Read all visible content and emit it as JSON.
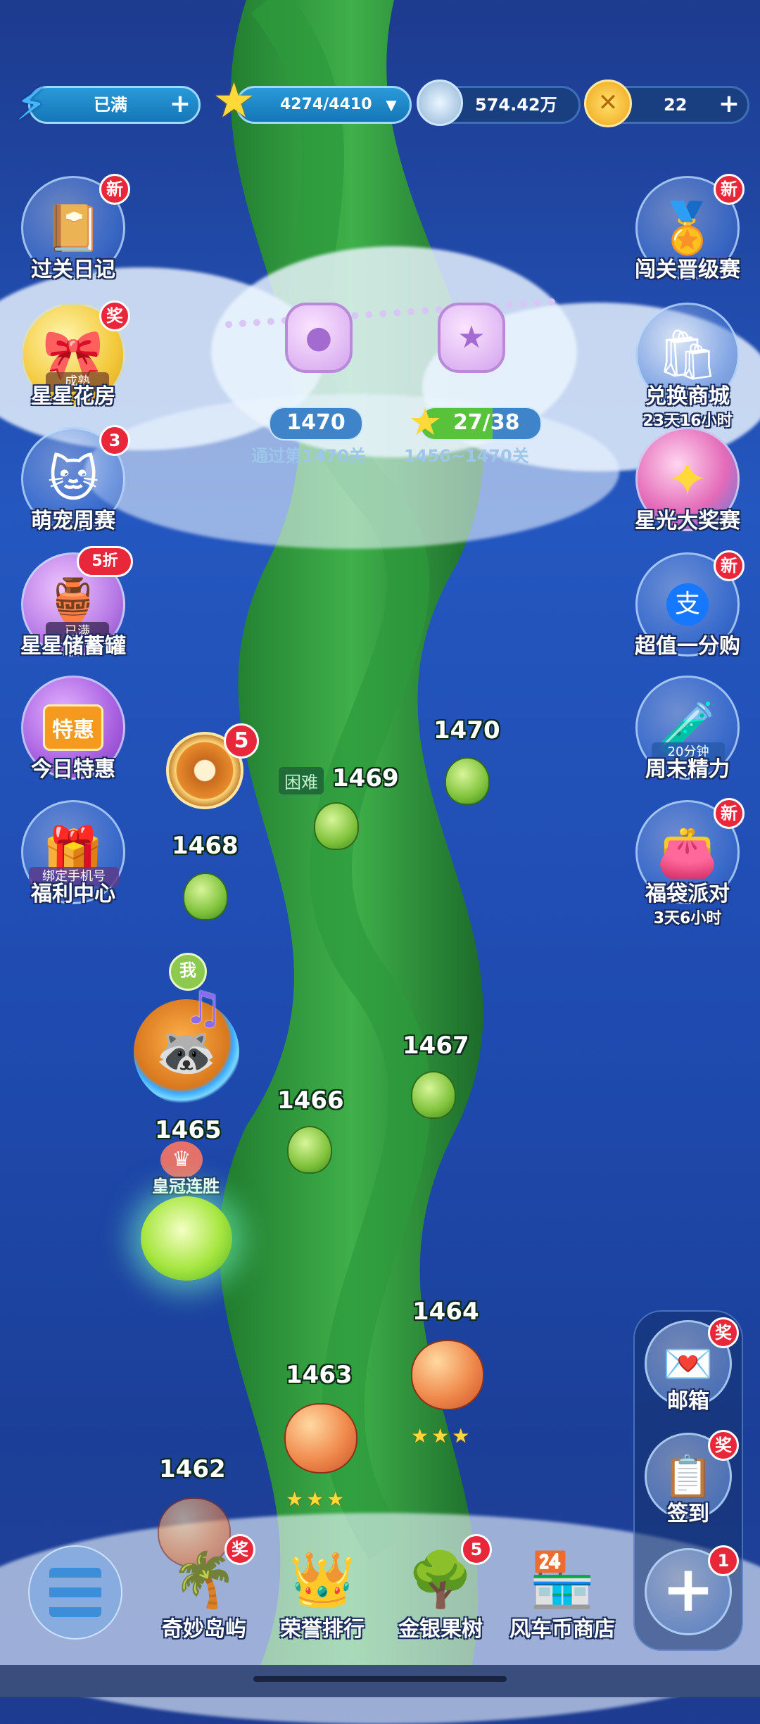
{
  "topbar": {
    "energy_label": "已满",
    "stars_value": "4274/4410",
    "coins_value": "574.42万",
    "gold_value": "22"
  },
  "left_menu": [
    {
      "label": "过关日记",
      "badge": "新",
      "icon": "diary-icon",
      "chip": ""
    },
    {
      "label": "星星花房",
      "badge": "奖",
      "icon": "flower-house-icon",
      "chip": "成熟"
    },
    {
      "label": "萌宠周赛",
      "badge": "3",
      "icon": "cat-icon",
      "chip": ""
    },
    {
      "label": "星星储蓄罐",
      "badge": "5折",
      "icon": "piggy-bank-icon",
      "chip": "已满"
    },
    {
      "label": "今日特惠",
      "badge": "",
      "icon": "shop-stall-icon",
      "chip": "特惠"
    },
    {
      "label": "福利中心",
      "badge": "",
      "icon": "gift-icon",
      "chip": "绑定手机号"
    }
  ],
  "right_menu": [
    {
      "label": "闯关晋级赛",
      "sub": "",
      "badge": "新",
      "icon": "trophy-badge-icon",
      "chip": ""
    },
    {
      "label": "兑换商城",
      "sub": "23天16小时",
      "badge": "",
      "icon": "exchange-shop-icon",
      "chip": ""
    },
    {
      "label": "星光大奖赛",
      "sub": "",
      "badge": "",
      "icon": "star-podium-icon",
      "chip": ""
    },
    {
      "label": "超值一分购",
      "sub": "",
      "badge": "新",
      "icon": "alipay-gift-icon",
      "chip": "支"
    },
    {
      "label": "周末精力",
      "sub": "",
      "badge": "",
      "icon": "potion-icon",
      "chip": "20分钟"
    },
    {
      "label": "福袋派对",
      "sub": "3天6小时",
      "badge": "新",
      "icon": "lucky-bag-icon",
      "chip": ""
    }
  ],
  "gate": {
    "pass_level": "1470",
    "pass_label": "通过第1470关",
    "stars_progress": "27/38",
    "stars_range": "1456~1470关"
  },
  "levels": {
    "l1470": "1470",
    "l1469": "1469",
    "l1469_tag": "困难",
    "l1468": "1468",
    "l1467": "1467",
    "l1466": "1466",
    "l1465": "1465",
    "l1464": "1464",
    "l1463": "1463",
    "l1462": "1462",
    "wheel_badge": "5",
    "me_label": "我",
    "crown_label": "皇冠连胜",
    "stars_1464": "★★★",
    "stars_1463": "★★★"
  },
  "right_panel": [
    {
      "label": "邮箱",
      "badge": "奖",
      "icon": "mail-icon"
    },
    {
      "label": "签到",
      "badge": "奖",
      "icon": "checkin-icon"
    },
    {
      "label": "",
      "badge": "1",
      "icon": "plus-icon"
    }
  ],
  "dock": [
    {
      "label": "奇妙岛屿",
      "badge": "奖",
      "icon": "island-icon"
    },
    {
      "label": "荣誉排行",
      "badge": "",
      "icon": "crown-rank-icon"
    },
    {
      "label": "金银果树",
      "badge": "5",
      "icon": "fruit-tree-icon"
    },
    {
      "label": "风车币商店",
      "badge": "",
      "icon": "store-icon"
    }
  ]
}
